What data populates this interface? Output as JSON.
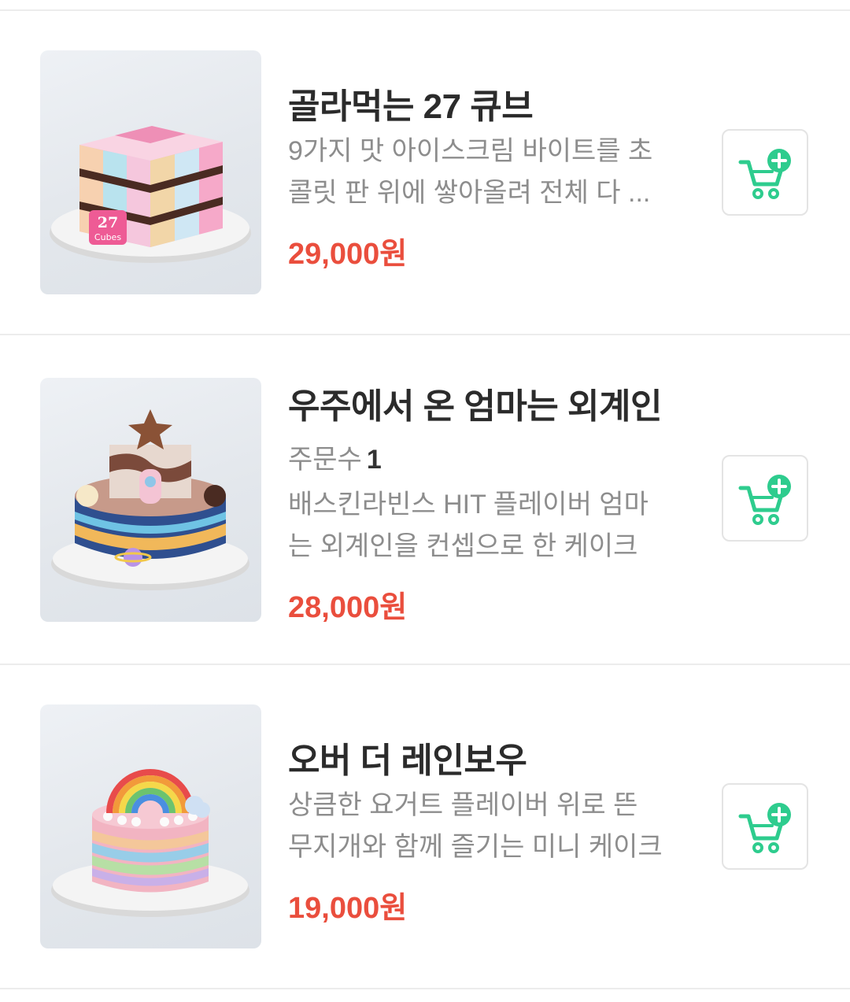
{
  "products": [
    {
      "name": "골라먹는 27 큐브",
      "description_lines": [
        "9가지 맛 아이스크림 바이트를 초",
        "콜릿 판 위에 쌓아올려 전체 다 ..."
      ],
      "price": "29,000원",
      "image": "27-cube-cake",
      "badge_top": "27",
      "badge_bottom": "Cubes"
    },
    {
      "name": "우주에서 온 엄마는 외계인",
      "order_label": "주문수",
      "order_count": "1",
      "description_lines": [
        "배스킨라빈스 HIT 플레이버 엄마",
        "는 외계인을 컨셉으로 한 케이크"
      ],
      "price": "28,000원",
      "image": "space-alien-cake"
    },
    {
      "name": "오버 더 레인보우",
      "description_lines": [
        "상큼한 요거트 플레이버 위로 뜬",
        "무지개와 함께 즐기는 미니 케이크"
      ],
      "price": "19,000원",
      "image": "rainbow-cake"
    }
  ],
  "cart_icon": "add-to-cart-icon",
  "colors": {
    "price": "#ea4e3d",
    "accent": "#2ecc8e"
  }
}
